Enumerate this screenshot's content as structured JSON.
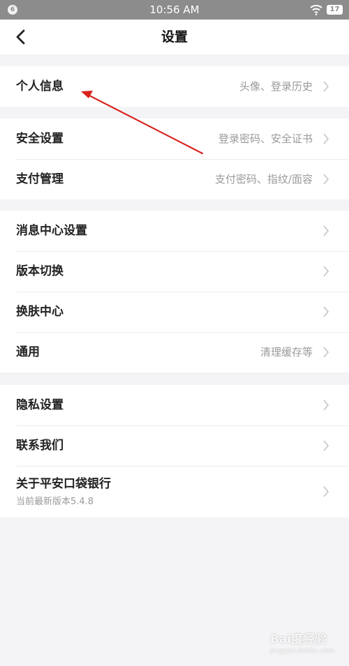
{
  "status_bar": {
    "notification_count": "6",
    "time": "10:56 AM",
    "battery": "17"
  },
  "header": {
    "title": "设置"
  },
  "groups": [
    [
      {
        "label": "个人信息",
        "hint": "头像、登录历史"
      }
    ],
    [
      {
        "label": "安全设置",
        "hint": "登录密码、安全证书"
      },
      {
        "label": "支付管理",
        "hint": "支付密码、指纹/面容"
      }
    ],
    [
      {
        "label": "消息中心设置",
        "hint": ""
      },
      {
        "label": "版本切换",
        "hint": ""
      },
      {
        "label": "换肤中心",
        "hint": ""
      },
      {
        "label": "通用",
        "hint": "清理缓存等"
      }
    ],
    [
      {
        "label": "隐私设置",
        "hint": ""
      },
      {
        "label": "联系我们",
        "hint": ""
      },
      {
        "label": "关于平安口袋银行",
        "sub": "当前最新版本5.4.8"
      }
    ]
  ],
  "annotation_color": "#d8231f",
  "watermark": {
    "brand": "Bai度经验",
    "sub": "jingyan.baidu.com"
  }
}
